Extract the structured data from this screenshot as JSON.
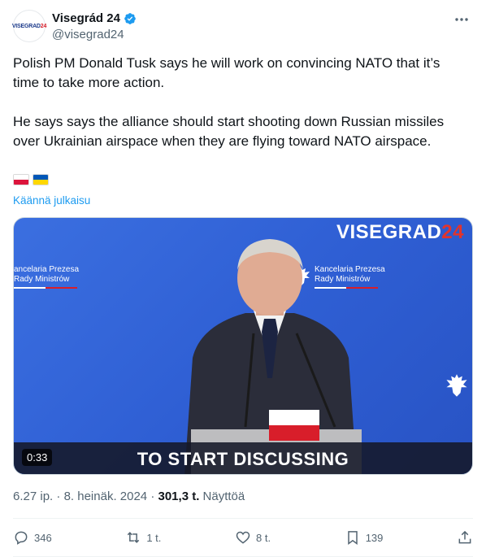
{
  "author": {
    "avatar_text_blue": "VISEGRAD",
    "avatar_text_red": "24",
    "display_name": "Visegrád 24",
    "handle": "@visegrad24"
  },
  "tweet": {
    "paragraph_1": "Polish PM Donald Tusk says he will work on convincing NATO that it’s time to take more action.",
    "paragraph_2": "He says says the alliance should start shooting down Russian missiles over Ukrainian airspace when they are flying toward NATO airspace.",
    "flags": [
      "poland-flag",
      "ukraine-flag"
    ],
    "translate_label": "Käännä julkaisu"
  },
  "media": {
    "watermark_main": "VISEGRAD",
    "watermark_accent": "24",
    "backdrop_left_line1": "ancelaria Prezesa",
    "backdrop_left_line2": "Rady Ministrów",
    "backdrop_mid_line1": "Kancelaria Prezesa",
    "backdrop_mid_line2": "Rady Ministrów",
    "subtitle": "TO START DISCUSSING",
    "duration": "0:33"
  },
  "meta": {
    "time": "6.27 ip.",
    "separator": "·",
    "date": "8. heinäk. 2024",
    "views_count": "301,3 t.",
    "views_label": "Näyttöä"
  },
  "actions": {
    "replies": "346",
    "reposts": "1 t.",
    "likes": "8 t.",
    "bookmarks": "139"
  },
  "colors": {
    "accent": "#1d9bf0",
    "secondary_text": "#536471",
    "media_blue": "#2f5fd4",
    "watermark_red": "#e2342d"
  }
}
